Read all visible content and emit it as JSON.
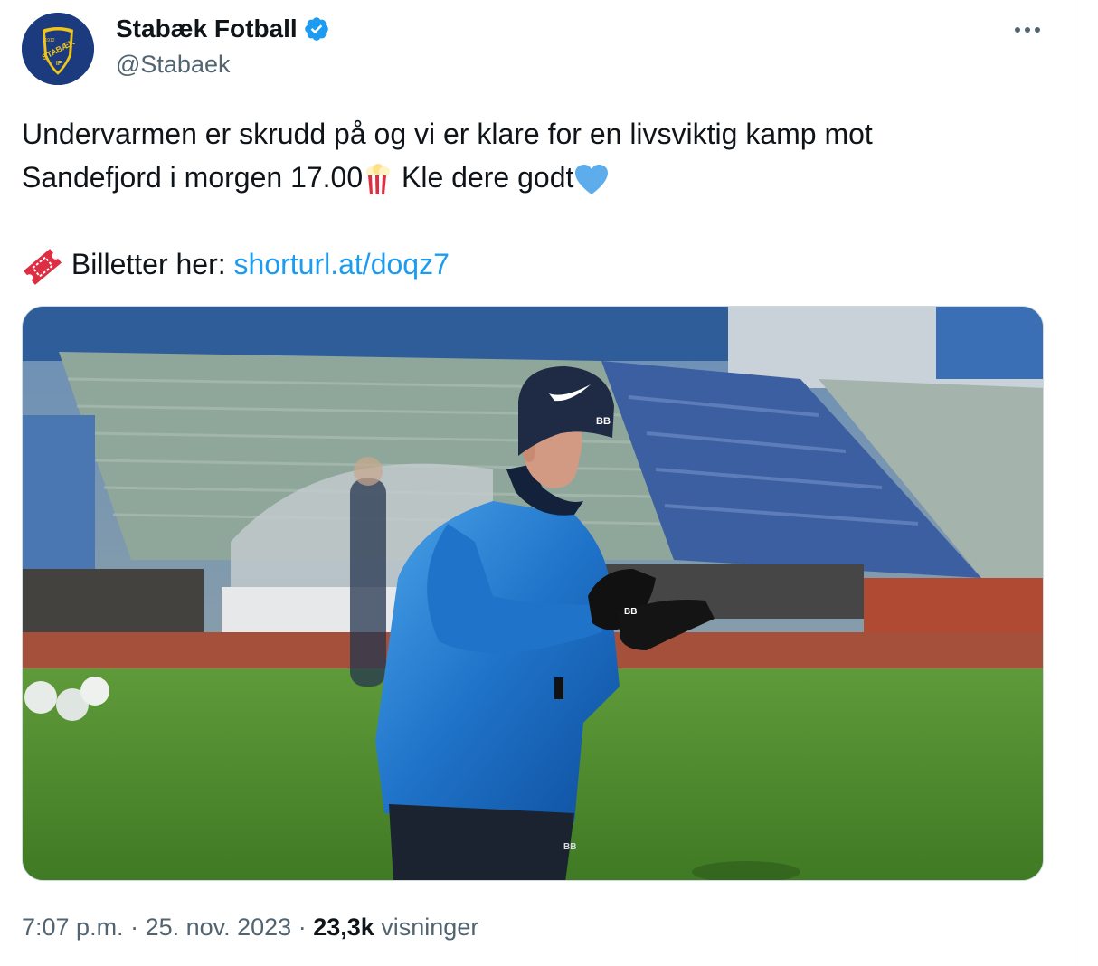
{
  "account": {
    "display_name": "Stabæk Fotball",
    "handle": "@Stabaek",
    "verified": true,
    "logo_text": "STABÆK",
    "logo_year": "1912",
    "logo_initials": "IF"
  },
  "tweet": {
    "line1": "Undervarmen er skrudd på og vi er klare for en livsviktig kamp mot",
    "line2_prefix": "Sandefjord i morgen 17.00",
    "line2_suffix": " Kle dere godt",
    "tickets_label": " Billetter her: ",
    "tickets_link": "shorturl.at/doqz7",
    "emojis": [
      "popcorn-icon",
      "blue-heart-icon",
      "ticket-icon"
    ]
  },
  "media": {
    "beanie_label": "BB",
    "glove_label": "BB",
    "pants_label": "BB"
  },
  "meta": {
    "time": "7:07 p.m.",
    "separator": " · ",
    "date": "25. nov. 2023",
    "views_count": "23,3k",
    "views_label": " visninger"
  },
  "colors": {
    "link": "#1d9bf0",
    "verified": "#1d9bf0",
    "secondary_text": "#536471"
  }
}
